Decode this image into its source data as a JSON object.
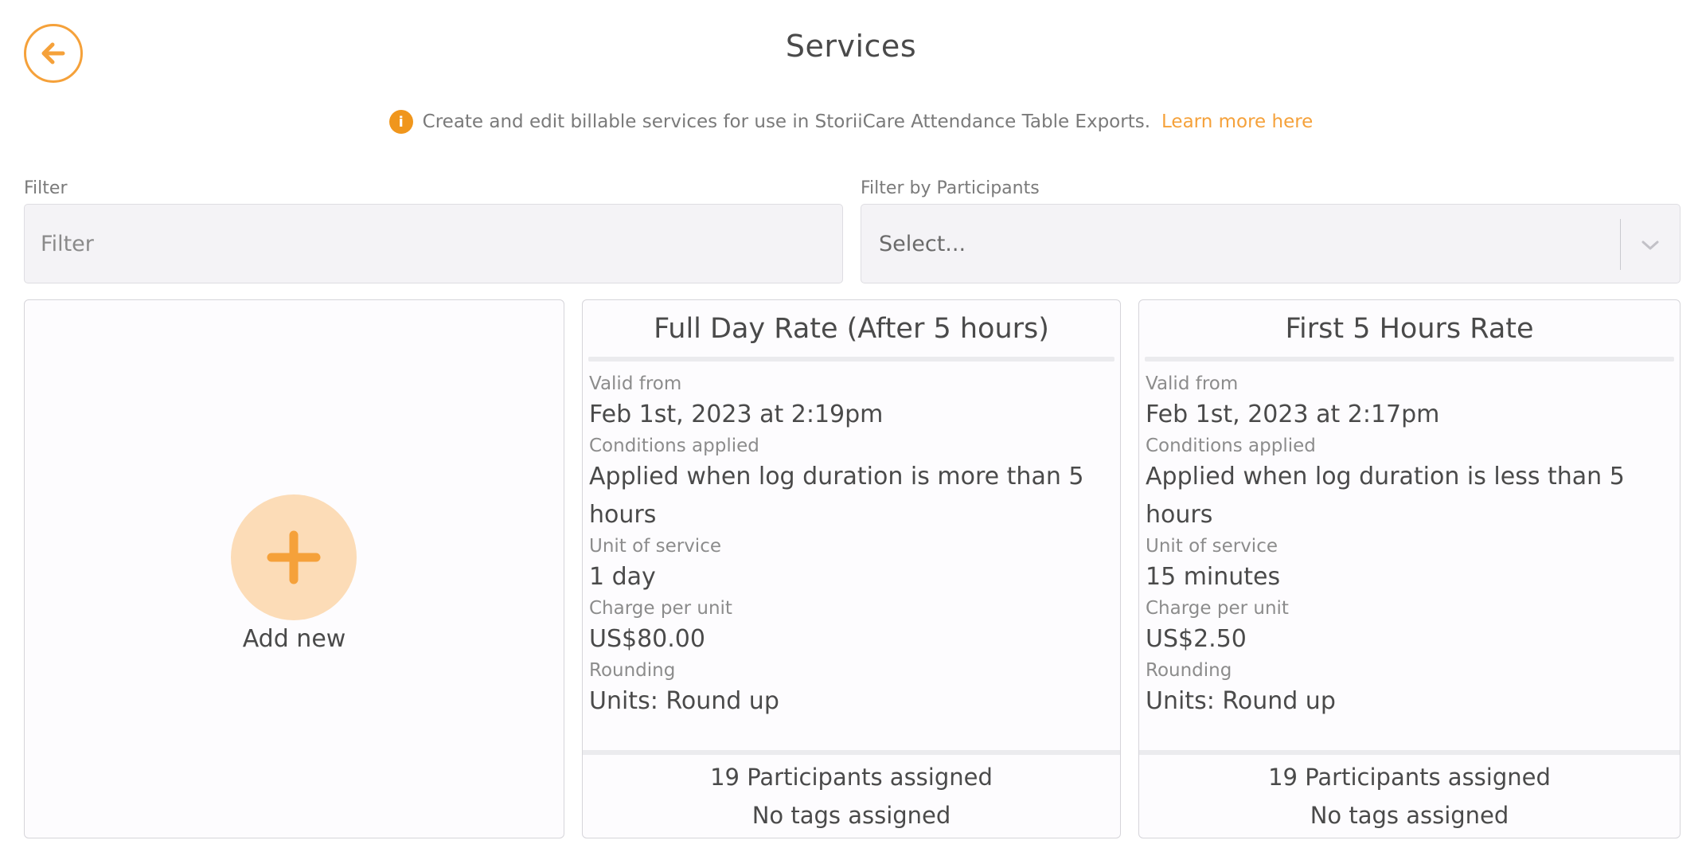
{
  "header": {
    "title": "Services",
    "back_icon": "arrow-left-icon"
  },
  "info": {
    "icon": "info-icon",
    "icon_glyph": "i",
    "text": "Create and edit billable services for use in StoriiCare Attendance Table Exports.",
    "link_text": "Learn more here"
  },
  "filters": {
    "text_filter": {
      "label": "Filter",
      "placeholder": "Filter",
      "value": ""
    },
    "participants_filter": {
      "label": "Filter by Participants",
      "value": "Select..."
    }
  },
  "add_card": {
    "label": "Add new",
    "icon": "plus-icon"
  },
  "labels": {
    "valid_from": "Valid from",
    "conditions": "Conditions applied",
    "unit": "Unit of service",
    "charge": "Charge per unit",
    "rounding": "Rounding"
  },
  "services": [
    {
      "name": "Full Day Rate (After 5 hours)",
      "valid_from": "Feb 1st, 2023 at 2:19pm",
      "conditions": "Applied when log duration is more than 5 hours",
      "unit": "1 day",
      "charge": "US$80.00",
      "rounding": "Units: Round up",
      "participants": "19 Participants assigned",
      "tags": "No tags assigned"
    },
    {
      "name": "First 5 Hours Rate",
      "valid_from": "Feb 1st, 2023 at 2:17pm",
      "conditions": "Applied when log duration is less than 5 hours",
      "unit": "15 minutes",
      "charge": "US$2.50",
      "rounding": "Units: Round up",
      "participants": "19 Participants assigned",
      "tags": "No tags assigned"
    }
  ],
  "colors": {
    "accent": "#f5a13a",
    "accent_light": "#fcdcb7",
    "info_icon": "#f0961c"
  }
}
